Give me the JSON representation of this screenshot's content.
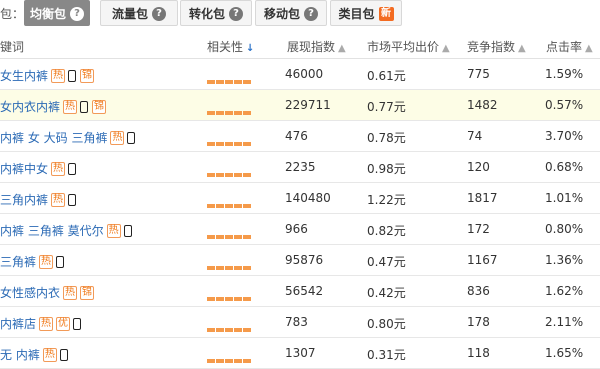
{
  "tabbar": {
    "label": "包：",
    "tabs": [
      {
        "label": "均衡包",
        "active": true,
        "badge": "?"
      },
      {
        "label": "流量包",
        "active": false,
        "badge": "?"
      },
      {
        "label": "转化包",
        "active": false,
        "badge": "?"
      },
      {
        "label": "移动包",
        "active": false,
        "badge": "?"
      },
      {
        "label": "类目包",
        "active": false,
        "badge": "新"
      }
    ]
  },
  "table": {
    "headers": {
      "keyword": "键词",
      "relevance": "相关性",
      "impressions": "展现指数",
      "avg_bid": "市场平均出价",
      "competition": "竞争指数",
      "ctr": "点击率"
    },
    "rows": [
      {
        "keyword": "女生内裤",
        "tags": [
          "热"
        ],
        "mobile": true,
        "extra_tag": "锦",
        "impressions": "46000",
        "avg_bid": "0.61元",
        "competition": "775",
        "ctr": "1.59%"
      },
      {
        "keyword": "女内衣内裤",
        "tags": [
          "热"
        ],
        "mobile": true,
        "extra_tag": "锦",
        "impressions": "229711",
        "avg_bid": "0.77元",
        "competition": "1482",
        "ctr": "0.57%"
      },
      {
        "keyword": "内裤 女 大码 三角裤",
        "tags": [
          "热"
        ],
        "mobile": true,
        "extra_tag": "",
        "impressions": "476",
        "avg_bid": "0.78元",
        "competition": "74",
        "ctr": "3.70%"
      },
      {
        "keyword": "内裤中女",
        "tags": [
          "热"
        ],
        "mobile": true,
        "extra_tag": "",
        "impressions": "2235",
        "avg_bid": "0.98元",
        "competition": "120",
        "ctr": "0.68%"
      },
      {
        "keyword": "三角内裤",
        "tags": [
          "热"
        ],
        "mobile": true,
        "extra_tag": "",
        "impressions": "140480",
        "avg_bid": "1.22元",
        "competition": "1817",
        "ctr": "1.01%"
      },
      {
        "keyword": "内裤 三角裤 莫代尔",
        "tags": [
          "热"
        ],
        "mobile": true,
        "extra_tag": "",
        "impressions": "966",
        "avg_bid": "0.82元",
        "competition": "172",
        "ctr": "0.80%"
      },
      {
        "keyword": "三角裤",
        "tags": [
          "热"
        ],
        "mobile": true,
        "extra_tag": "",
        "impressions": "95876",
        "avg_bid": "0.47元",
        "competition": "1167",
        "ctr": "1.36%"
      },
      {
        "keyword": "女性感内衣",
        "tags": [
          "热"
        ],
        "mobile": false,
        "extra_tag": "锦",
        "impressions": "56542",
        "avg_bid": "0.42元",
        "competition": "836",
        "ctr": "1.62%"
      },
      {
        "keyword": "内裤店",
        "tags": [
          "热",
          "优"
        ],
        "mobile": true,
        "extra_tag": "",
        "impressions": "783",
        "avg_bid": "0.80元",
        "competition": "178",
        "ctr": "2.11%"
      },
      {
        "keyword": "无 内裤",
        "tags": [
          "热"
        ],
        "mobile": true,
        "extra_tag": "",
        "impressions": "1307",
        "avg_bid": "0.31元",
        "competition": "118",
        "ctr": "1.65%"
      }
    ],
    "relevance_level": 5
  },
  "colors": {
    "accent_tab": "#888888",
    "keyword_link": "#2b6ab5",
    "tag_orange": "#f07a1a",
    "relevance_bar": "#f59a4a",
    "highlight_row": "#fdfde6"
  }
}
